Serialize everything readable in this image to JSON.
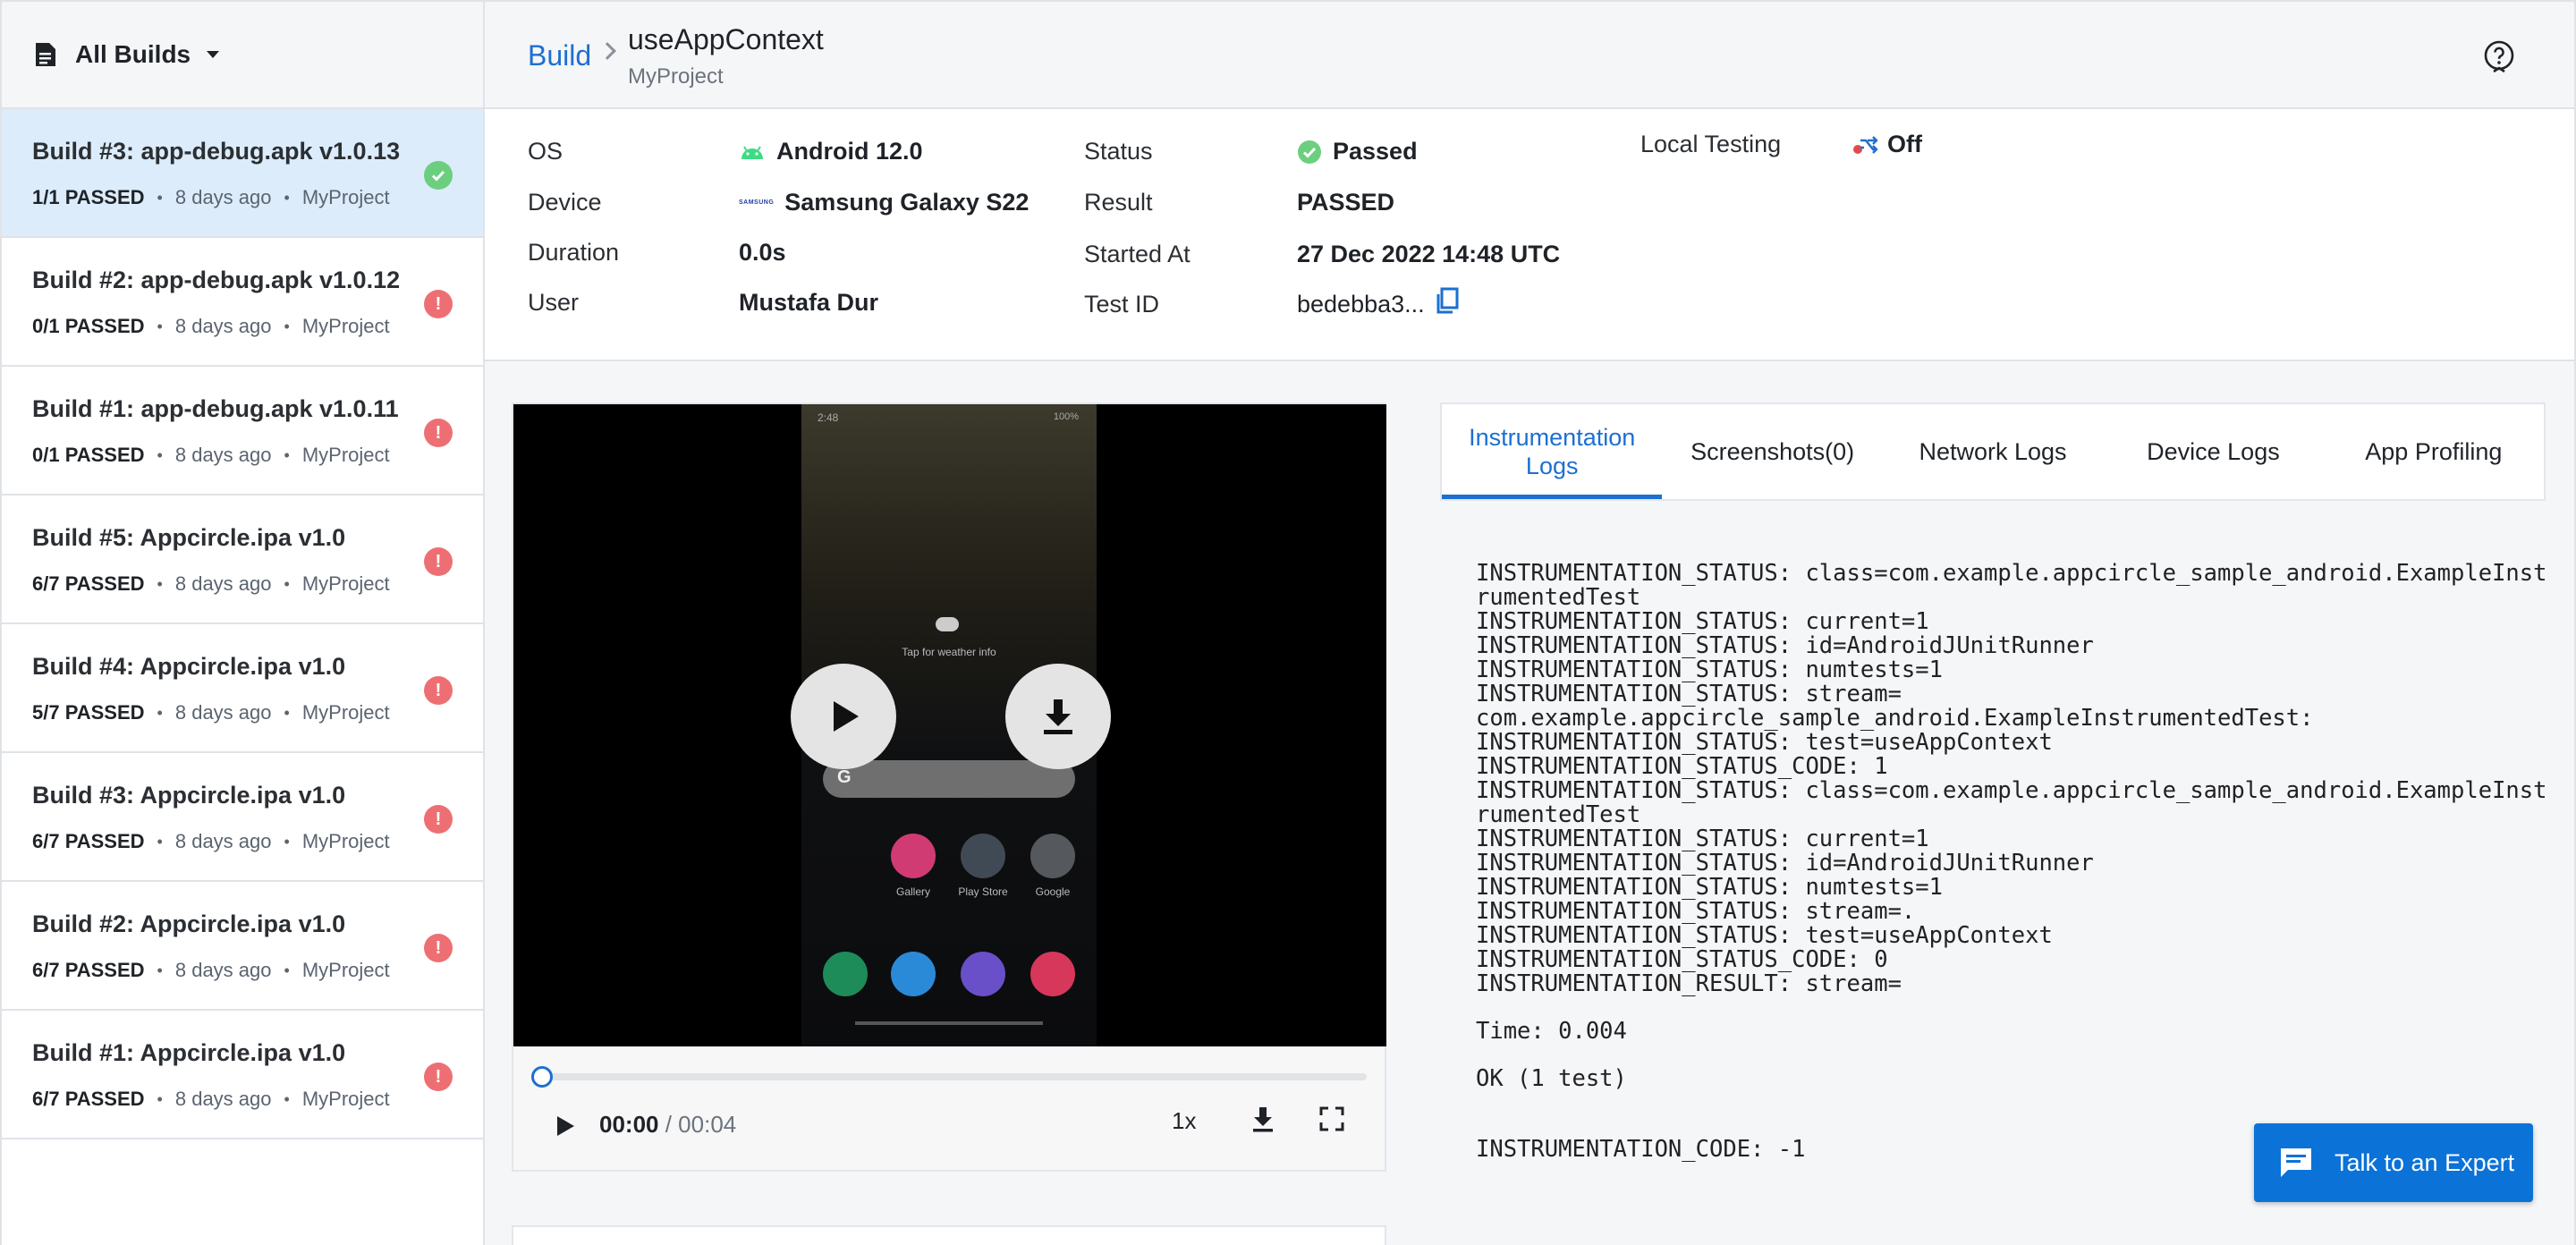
{
  "sidebar": {
    "title": "All Builds",
    "builds": [
      {
        "name": "Build #3: app-debug.apk v1.0.13",
        "passed": "1/1 PASSED",
        "time": "8 days ago",
        "project": "MyProject",
        "status": "ok"
      },
      {
        "name": "Build #2: app-debug.apk v1.0.12",
        "passed": "0/1 PASSED",
        "time": "8 days ago",
        "project": "MyProject",
        "status": "err"
      },
      {
        "name": "Build #1: app-debug.apk v1.0.11",
        "passed": "0/1 PASSED",
        "time": "8 days ago",
        "project": "MyProject",
        "status": "err"
      },
      {
        "name": "Build #5: Appcircle.ipa v1.0",
        "passed": "6/7 PASSED",
        "time": "8 days ago",
        "project": "MyProject",
        "status": "err"
      },
      {
        "name": "Build #4: Appcircle.ipa v1.0",
        "passed": "5/7 PASSED",
        "time": "8 days ago",
        "project": "MyProject",
        "status": "err"
      },
      {
        "name": "Build #3: Appcircle.ipa v1.0",
        "passed": "6/7 PASSED",
        "time": "8 days ago",
        "project": "MyProject",
        "status": "err"
      },
      {
        "name": "Build #2: Appcircle.ipa v1.0",
        "passed": "6/7 PASSED",
        "time": "8 days ago",
        "project": "MyProject",
        "status": "err"
      },
      {
        "name": "Build #1: Appcircle.ipa v1.0",
        "passed": "6/7 PASSED",
        "time": "8 days ago",
        "project": "MyProject",
        "status": "err"
      }
    ]
  },
  "header": {
    "breadcrumb": "Build",
    "title": "useAppContext",
    "subtitle": "MyProject"
  },
  "info": {
    "os_label": "OS",
    "os_value": "Android 12.0",
    "device_label": "Device",
    "device_value": "Samsung Galaxy S22",
    "device_logo": "SAMSUNG",
    "duration_label": "Duration",
    "duration_value": "0.0s",
    "user_label": "User",
    "user_value": "Mustafa Dur",
    "status_label": "Status",
    "status_value": "Passed",
    "result_label": "Result",
    "result_value": "PASSED",
    "started_label": "Started At",
    "started_value": "27 Dec 2022 14:48 UTC",
    "testid_label": "Test ID",
    "testid_value": "bedebba3...",
    "local_label": "Local Testing",
    "local_value": "Off"
  },
  "video": {
    "phone_clock": "2:48",
    "phone_battery": "100%",
    "weather_hint": "Tap for weather info",
    "apps": [
      "Gallery",
      "Play Store",
      "Google"
    ],
    "current_time": "00:00",
    "separator": " / ",
    "total_time": "00:04",
    "speed": "1x",
    "progress": 0
  },
  "tabs": [
    "Instrumentation Logs",
    "Screenshots(0)",
    "Network Logs",
    "Device Logs",
    "App Profiling"
  ],
  "logs": {
    "block1": [
      "INSTRUMENTATION_STATUS: class=com.example.appcircle_sample_android.ExampleInstrumentedTest",
      "INSTRUMENTATION_STATUS: current=1",
      "INSTRUMENTATION_STATUS: id=AndroidJUnitRunner",
      "INSTRUMENTATION_STATUS: numtests=1",
      "INSTRUMENTATION_STATUS: stream=",
      "com.example.appcircle_sample_android.ExampleInstrumentedTest:",
      "INSTRUMENTATION_STATUS: test=useAppContext",
      "INSTRUMENTATION_STATUS_CODE: 1",
      "INSTRUMENTATION_STATUS: class=com.example.appcircle_sample_android.ExampleInstrumentedTest",
      "INSTRUMENTATION_STATUS: current=1",
      "INSTRUMENTATION_STATUS: id=AndroidJUnitRunner",
      "INSTRUMENTATION_STATUS: numtests=1",
      "INSTRUMENTATION_STATUS: stream=.",
      "INSTRUMENTATION_STATUS: test=useAppContext",
      "INSTRUMENTATION_STATUS_CODE: 0",
      "INSTRUMENTATION_RESULT: stream="
    ],
    "time_line": "Time: 0.004",
    "ok_line": "OK (1 test)",
    "code_line": "INSTRUMENTATION_CODE: -1"
  },
  "talk": {
    "label": "Talk to an Expert"
  },
  "colors": {
    "accent": "#1d6fd1",
    "success": "#6ccf7f",
    "error": "#ee6f73"
  }
}
